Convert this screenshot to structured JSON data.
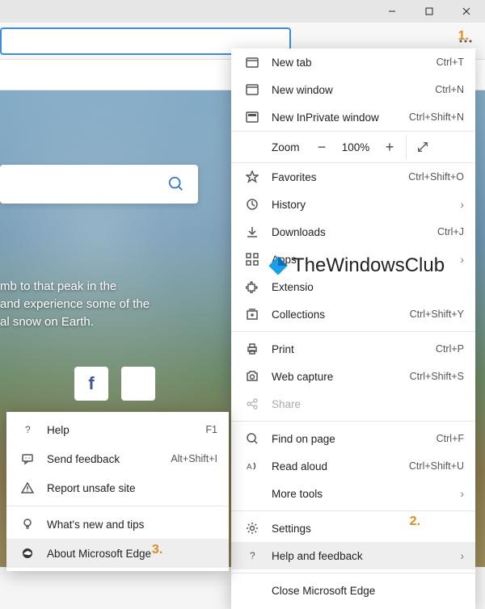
{
  "window": {
    "minimize": "−",
    "maximize": "▢",
    "close": "✕"
  },
  "callouts": {
    "one": "1.",
    "two": "2.",
    "three": "3."
  },
  "watermark": "TheWindowsClub",
  "hero": {
    "line1": "mb to that peak in the",
    "line2": "and experience some of the",
    "line3": "al snow on Earth."
  },
  "menu": {
    "new_tab": {
      "label": "New tab",
      "accel": "Ctrl+T"
    },
    "new_win": {
      "label": "New window",
      "accel": "Ctrl+N"
    },
    "inprivate": {
      "label": "New InPrivate window",
      "accel": "Ctrl+Shift+N"
    },
    "zoom": {
      "label": "Zoom",
      "value": "100%"
    },
    "favorites": {
      "label": "Favorites",
      "accel": "Ctrl+Shift+O"
    },
    "history": {
      "label": "History"
    },
    "downloads": {
      "label": "Downloads",
      "accel": "Ctrl+J"
    },
    "apps": {
      "label": "Apps"
    },
    "extensions": {
      "label": "Extensio"
    },
    "collections": {
      "label": "Collections",
      "accel": "Ctrl+Shift+Y"
    },
    "print": {
      "label": "Print",
      "accel": "Ctrl+P"
    },
    "capture": {
      "label": "Web capture",
      "accel": "Ctrl+Shift+S"
    },
    "share": {
      "label": "Share"
    },
    "find": {
      "label": "Find on page",
      "accel": "Ctrl+F"
    },
    "read": {
      "label": "Read aloud",
      "accel": "Ctrl+Shift+U"
    },
    "more": {
      "label": "More tools"
    },
    "settings": {
      "label": "Settings"
    },
    "help": {
      "label": "Help and feedback"
    },
    "close_edge": {
      "label": "Close Microsoft Edge"
    }
  },
  "submenu": {
    "help": {
      "label": "Help",
      "accel": "F1"
    },
    "feedback": {
      "label": "Send feedback",
      "accel": "Alt+Shift+I"
    },
    "unsafe": {
      "label": "Report unsafe site"
    },
    "whatsnew": {
      "label": "What's new and tips"
    },
    "about": {
      "label": "About Microsoft Edge"
    }
  }
}
